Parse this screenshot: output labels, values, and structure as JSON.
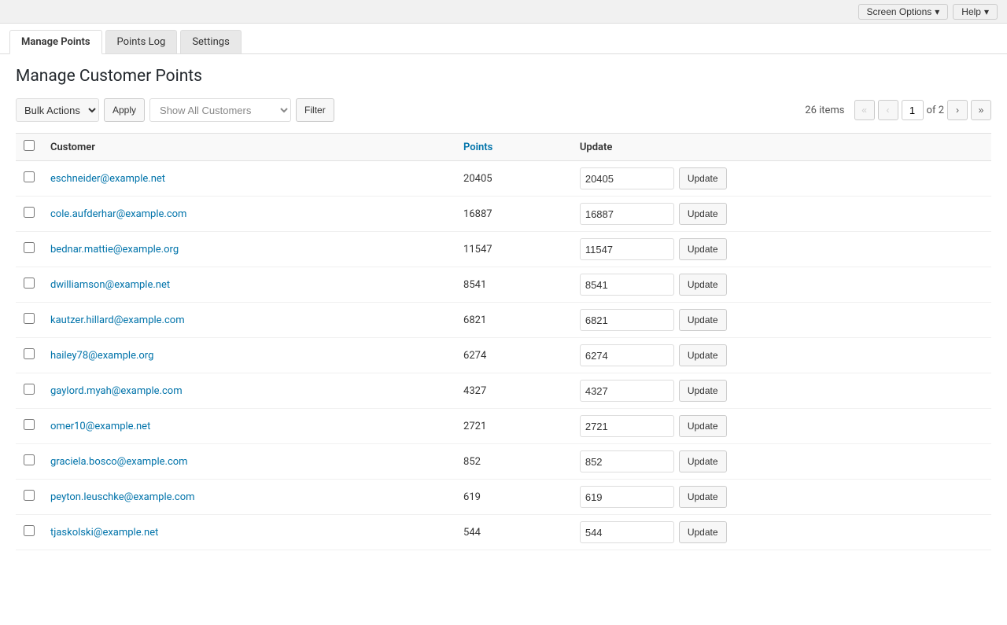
{
  "topbar": {
    "screen_options_label": "Screen Options",
    "help_label": "Help"
  },
  "tabs": [
    {
      "id": "manage-points",
      "label": "Manage Points",
      "active": true
    },
    {
      "id": "points-log",
      "label": "Points Log",
      "active": false
    },
    {
      "id": "settings",
      "label": "Settings",
      "active": false
    }
  ],
  "page": {
    "title": "Manage Customer Points"
  },
  "toolbar": {
    "bulk_actions_label": "Bulk Actions",
    "apply_label": "Apply",
    "show_all_customers_placeholder": "Show All Customers",
    "filter_label": "Filter",
    "items_count": "26 items",
    "of_text": "of 2",
    "current_page": "1"
  },
  "table": {
    "headers": {
      "checkbox": "",
      "customer": "Customer",
      "points": "Points",
      "update": "Update"
    },
    "rows": [
      {
        "email": "eschneider@example.net",
        "points": "20405",
        "update_value": "20405"
      },
      {
        "email": "cole.aufderhar@example.com",
        "points": "16887",
        "update_value": "16887"
      },
      {
        "email": "bednar.mattie@example.org",
        "points": "11547",
        "update_value": "11547"
      },
      {
        "email": "dwilliamson@example.net",
        "points": "8541",
        "update_value": "8541"
      },
      {
        "email": "kautzer.hillard@example.com",
        "points": "6821",
        "update_value": "6821"
      },
      {
        "email": "hailey78@example.org",
        "points": "6274",
        "update_value": "6274"
      },
      {
        "email": "gaylord.myah@example.com",
        "points": "4327",
        "update_value": "4327"
      },
      {
        "email": "omer10@example.net",
        "points": "2721",
        "update_value": "2721"
      },
      {
        "email": "graciela.bosco@example.com",
        "points": "852",
        "update_value": "852"
      },
      {
        "email": "peyton.leuschke@example.com",
        "points": "619",
        "update_value": "619"
      },
      {
        "email": "tjaskolski@example.net",
        "points": "544",
        "update_value": "544"
      }
    ],
    "update_button_label": "Update"
  }
}
